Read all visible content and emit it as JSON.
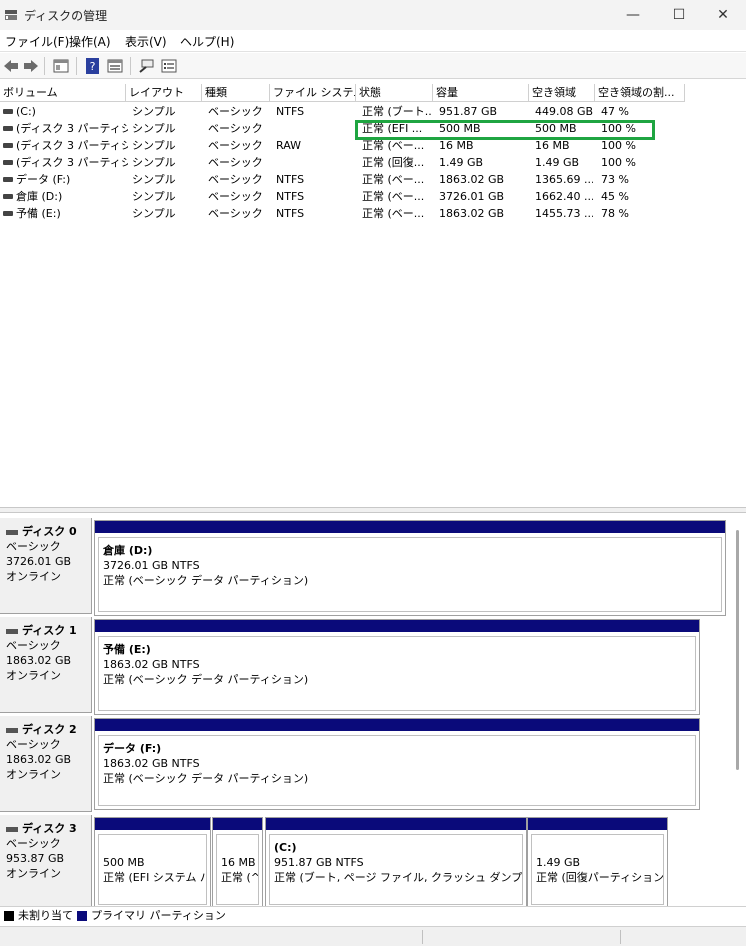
{
  "window": {
    "title": "ディスクの管理",
    "minimize": "—",
    "maximize": "☐",
    "close": "✕"
  },
  "menu": {
    "file": "ファイル(F)",
    "action": "操作(A)",
    "view": "表示(V)",
    "help": "ヘルプ(H)"
  },
  "toolbar": {
    "icons": [
      "back-icon",
      "forward-icon",
      "properties-icon",
      "help-icon",
      "view-icon",
      "connect-icon",
      "list-icon"
    ]
  },
  "columns": [
    "ボリューム",
    "レイアウト",
    "種類",
    "ファイル システム",
    "状態",
    "容量",
    "空き領域",
    "空き領域の割..."
  ],
  "volumes": [
    {
      "name": "(C:)",
      "layout": "シンプル",
      "type": "ベーシック",
      "fs": "NTFS",
      "status": "正常 (ブート...",
      "capacity": "951.87 GB",
      "free": "449.08 GB",
      "pct": "47 %"
    },
    {
      "name": "(ディスク 3 パーティシ...",
      "layout": "シンプル",
      "type": "ベーシック",
      "fs": "",
      "status": "正常 (EFI ...",
      "capacity": "500 MB",
      "free": "500 MB",
      "pct": "100 %"
    },
    {
      "name": "(ディスク 3 パーティシ...",
      "layout": "シンプル",
      "type": "ベーシック",
      "fs": "RAW",
      "status": "正常 (ベー...",
      "capacity": "16 MB",
      "free": "16 MB",
      "pct": "100 %"
    },
    {
      "name": "(ディスク 3 パーティシ...",
      "layout": "シンプル",
      "type": "ベーシック",
      "fs": "",
      "status": "正常 (回復...",
      "capacity": "1.49 GB",
      "free": "1.49 GB",
      "pct": "100 %"
    },
    {
      "name": "データ (F:)",
      "layout": "シンプル",
      "type": "ベーシック",
      "fs": "NTFS",
      "status": "正常 (ベー...",
      "capacity": "1863.02 GB",
      "free": "1365.69 ...",
      "pct": "73 %"
    },
    {
      "name": "倉庫 (D:)",
      "layout": "シンプル",
      "type": "ベーシック",
      "fs": "NTFS",
      "status": "正常 (ベー...",
      "capacity": "3726.01 GB",
      "free": "1662.40 ...",
      "pct": "45 %"
    },
    {
      "name": "予備 (E:)",
      "layout": "シンプル",
      "type": "ベーシック",
      "fs": "NTFS",
      "status": "正常 (ベー...",
      "capacity": "1863.02 GB",
      "free": "1455.73 ...",
      "pct": "78 %"
    }
  ],
  "disks": [
    {
      "name": "ディスク 0",
      "kind": "ベーシック",
      "size": "3726.01 GB",
      "state": "オンライン",
      "partitions": [
        {
          "name": "倉庫  (D:)",
          "size": "3726.01 GB NTFS",
          "status": "正常 (ベーシック データ パーティション)"
        }
      ]
    },
    {
      "name": "ディスク 1",
      "kind": "ベーシック",
      "size": "1863.02 GB",
      "state": "オンライン",
      "partitions": [
        {
          "name": "予備  (E:)",
          "size": "1863.02 GB NTFS",
          "status": "正常 (ベーシック データ パーティション)"
        }
      ]
    },
    {
      "name": "ディスク 2",
      "kind": "ベーシック",
      "size": "1863.02 GB",
      "state": "オンライン",
      "partitions": [
        {
          "name": "データ  (F:)",
          "size": "1863.02 GB NTFS",
          "status": "正常 (ベーシック データ パーティション)"
        }
      ]
    },
    {
      "name": "ディスク 3",
      "kind": "ベーシック",
      "size": "953.87 GB",
      "state": "オンライン",
      "partitions": [
        {
          "name": "",
          "size": "500 MB",
          "status": "正常 (EFI システム パ"
        },
        {
          "name": "",
          "size": "16 MB",
          "status": "正常 (^"
        },
        {
          "name": "(C:)",
          "size": "951.87 GB NTFS",
          "status": "正常 (ブート, ページ ファイル, クラッシュ ダンプ, ベーシッ"
        },
        {
          "name": "",
          "size": "1.49 GB",
          "status": "正常 (回復パーティション)"
        }
      ]
    }
  ],
  "legend": {
    "unallocated": "未割り当て",
    "primary": "プライマリ パーティション",
    "unallocated_color": "#000000",
    "primary_color": "#0a0a7a"
  },
  "colors": {
    "highlight": "#1fa541",
    "partition_bar": "#0a0a7a"
  }
}
